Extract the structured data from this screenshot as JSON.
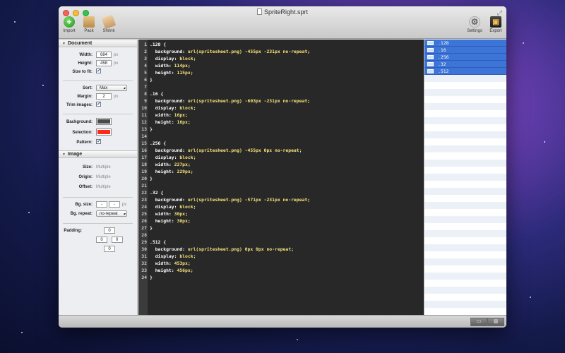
{
  "window": {
    "title": "SpriteRight.sprt"
  },
  "toolbar": {
    "import_label": "Import",
    "pack_label": "Pack",
    "shrink_label": "Shrink",
    "settings_label": "Settings",
    "export_label": "Export"
  },
  "document": {
    "header": "Document",
    "width_label": "Width:",
    "width_value": "684",
    "width_unit": "px",
    "height_label": "Height:",
    "height_value": "458",
    "height_unit": "px",
    "size_to_fit_label": "Size to fit:",
    "sort_label": "Sort:",
    "sort_value": "Max",
    "margin_label": "Margin:",
    "margin_value": "2",
    "margin_unit": "px",
    "trim_label": "Trim images:",
    "background_label": "Background:",
    "background_color": "#4a4a4a",
    "selection_label": "Selection:",
    "selection_color": "#ff2a1a",
    "pattern_label": "Pattern:"
  },
  "image": {
    "header": "Image",
    "size_label": "Size:",
    "size_value": "Multiple",
    "origin_label": "Origin:",
    "origin_value": "Multiple",
    "offset_label": "Offset:",
    "offset_value": "Multiple",
    "bgsize_label": "Bg. size:",
    "bgsize_w": "-",
    "bgsize_h": "-",
    "bgsize_unit": "px",
    "bgrepeat_label": "Bg. repeat:",
    "bgrepeat_value": "no-repeat",
    "padding_label": "Padding:",
    "padding_top": "0",
    "padding_left": "0",
    "padding_right": "0",
    "padding_bottom": "0"
  },
  "code_lines": [
    {
      "n": "1",
      "t": ".128 {"
    },
    {
      "n": "2",
      "t": "  background: url(spritesheet.png) -455px -231px no-repeat;"
    },
    {
      "n": "3",
      "t": "  display: block;"
    },
    {
      "n": "4",
      "t": "  width: 114px;"
    },
    {
      "n": "5",
      "t": "  height: 115px;"
    },
    {
      "n": "6",
      "t": "}"
    },
    {
      "n": "7",
      "t": ""
    },
    {
      "n": "8",
      "t": ".16 {"
    },
    {
      "n": "9",
      "t": "  background: url(spritesheet.png) -603px -231px no-repeat;"
    },
    {
      "n": "10",
      "t": "  display: block;"
    },
    {
      "n": "11",
      "t": "  width: 16px;"
    },
    {
      "n": "12",
      "t": "  height: 16px;"
    },
    {
      "n": "13",
      "t": "}"
    },
    {
      "n": "14",
      "t": ""
    },
    {
      "n": "15",
      "t": ".256 {"
    },
    {
      "n": "16",
      "t": "  background: url(spritesheet.png) -455px 0px no-repeat;"
    },
    {
      "n": "17",
      "t": "  display: block;"
    },
    {
      "n": "18",
      "t": "  width: 227px;"
    },
    {
      "n": "19",
      "t": "  height: 229px;"
    },
    {
      "n": "20",
      "t": "}"
    },
    {
      "n": "21",
      "t": ""
    },
    {
      "n": "22",
      "t": ".32 {"
    },
    {
      "n": "23",
      "t": "  background: url(spritesheet.png) -571px -231px no-repeat;"
    },
    {
      "n": "24",
      "t": "  display: block;"
    },
    {
      "n": "25",
      "t": "  width: 30px;"
    },
    {
      "n": "26",
      "t": "  height: 30px;"
    },
    {
      "n": "27",
      "t": "}"
    },
    {
      "n": "28",
      "t": ""
    },
    {
      "n": "29",
      "t": ".512 {"
    },
    {
      "n": "30",
      "t": "  background: url(spritesheet.png) 0px 0px no-repeat;"
    },
    {
      "n": "31",
      "t": "  display: block;"
    },
    {
      "n": "32",
      "t": "  width: 453px;"
    },
    {
      "n": "33",
      "t": "  height: 456px;"
    },
    {
      "n": "34",
      "t": "}"
    }
  ],
  "sprite_list": [
    ".128",
    ".16",
    ".256",
    ".32",
    ".512"
  ],
  "colors": {
    "editor_bg": "#282828",
    "selection_blue": "#3d74d8"
  }
}
